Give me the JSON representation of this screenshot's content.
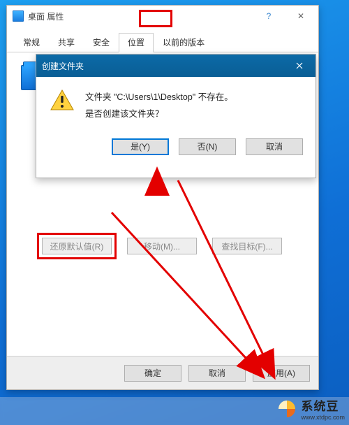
{
  "desktop": {},
  "main_window": {
    "title": "桌面 属性",
    "tabs": {
      "general": "常规",
      "sharing": "共享",
      "security": "安全",
      "location": "位置",
      "previous": "以前的版本"
    },
    "buttons": {
      "restore_default": "还原默认值(R)",
      "move": "移动(M)...",
      "find_target": "查找目标(F)..."
    },
    "footer": {
      "ok": "确定",
      "cancel": "取消",
      "apply": "应用(A)"
    },
    "help_icon": "?",
    "close_icon": "✕"
  },
  "dialog": {
    "title": "创建文件夹",
    "message_line1": "文件夹 \"C:\\Users\\1\\Desktop\" 不存在。",
    "message_line2": "是否创建该文件夹？",
    "buttons": {
      "yes": "是(Y)",
      "no": "否(N)",
      "cancel": "取消"
    }
  },
  "watermark": {
    "text": "系统豆",
    "url": "www.xtdpc.com"
  }
}
